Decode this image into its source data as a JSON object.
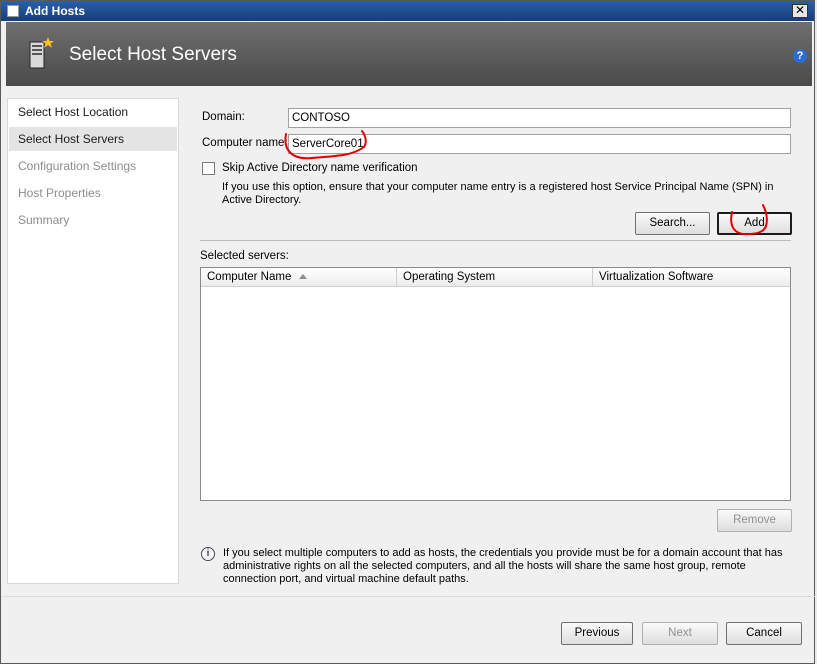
{
  "window": {
    "title": "Add Hosts",
    "close_glyph": "✕"
  },
  "header": {
    "title": "Select Host Servers",
    "help_glyph": "?"
  },
  "nav": {
    "items": [
      {
        "label": "Select Host Location",
        "state": "normal"
      },
      {
        "label": "Select Host Servers",
        "state": "selected"
      },
      {
        "label": "Configuration Settings",
        "state": "disabled"
      },
      {
        "label": "Host Properties",
        "state": "disabled"
      },
      {
        "label": "Summary",
        "state": "disabled"
      }
    ]
  },
  "form": {
    "domain_label": "Domain:",
    "domain_value": "CONTOSO",
    "computer_label": "Computer name:",
    "computer_value": "ServerCore01",
    "skip_label": "Skip Active Directory name verification",
    "skip_checked": false,
    "skip_hint": "If you use this option, ensure that your computer name entry is a registered host Service Principal Name (SPN) in Active Directory.",
    "search_button": "Search...",
    "add_button": "Add"
  },
  "servers": {
    "label": "Selected servers:",
    "columns": [
      "Computer Name",
      "Operating System",
      "Virtualization Software"
    ],
    "rows": [],
    "remove_button": "Remove"
  },
  "info_text": "If you select multiple computers to add as hosts, the credentials you provide must be for a domain account that has administrative rights on all the selected computers, and all the hosts will share the same host group, remote connection port, and virtual machine default paths.",
  "info_glyph": "i",
  "footer": {
    "previous": "Previous",
    "next": "Next",
    "cancel": "Cancel"
  },
  "colors": {
    "annotation": "#e00000",
    "header_bg": "#5a5a5a",
    "titlebar": "#1f4f93"
  }
}
